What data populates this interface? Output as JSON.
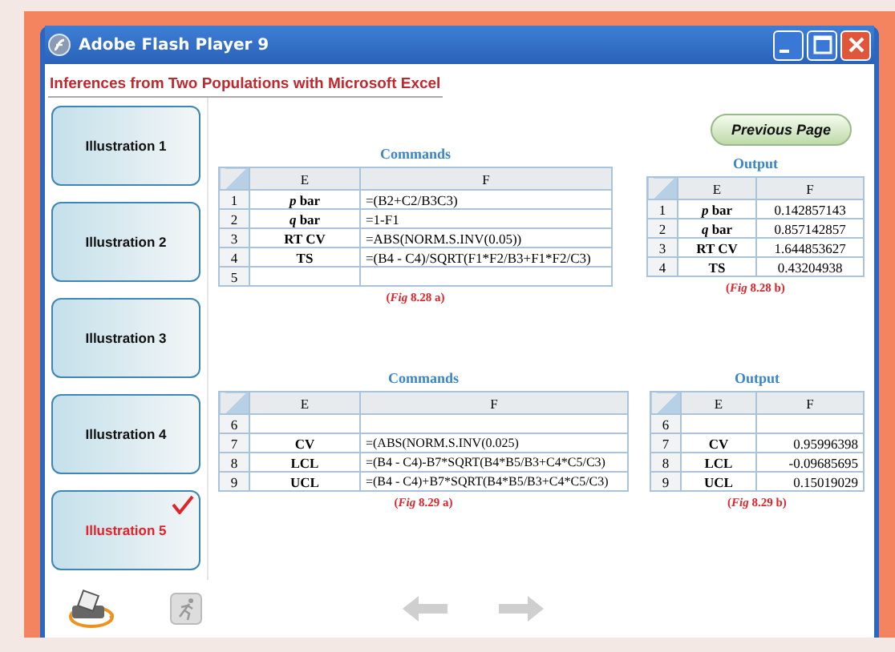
{
  "window": {
    "title": "Adobe Flash Player 9"
  },
  "heading": "Inferences from Two Populations with Microsoft Excel",
  "illustrations": [
    {
      "label": "Illustration 1",
      "selected": false,
      "checked": false
    },
    {
      "label": "Illustration 2",
      "selected": false,
      "checked": false
    },
    {
      "label": "Illustration 3",
      "selected": false,
      "checked": false
    },
    {
      "label": "Illustration 4",
      "selected": false,
      "checked": false
    },
    {
      "label": "Illustration 5",
      "selected": true,
      "checked": true
    }
  ],
  "previous_button": "Previous Page",
  "figures": [
    {
      "commands": {
        "title": "Commands",
        "columns": [
          "E",
          "F"
        ],
        "rows": [
          {
            "row": "1",
            "e": "*p* bar",
            "f": "=(B2+C2/B3C3)"
          },
          {
            "row": "2",
            "e": "*q* bar",
            "f": "=1-F1"
          },
          {
            "row": "3",
            "e": "RT CV",
            "f": "=ABS(NORM.S.INV(0.05))"
          },
          {
            "row": "4",
            "e": "TS",
            "f": "=(B4 - C4)/SQRT(F1*F2/B3+F1*F2/C3)"
          },
          {
            "row": "5"
          }
        ],
        "caption": "(*Fig* 8.28 a)"
      },
      "output": {
        "title": "Output",
        "columns": [
          "E",
          "F"
        ],
        "rows": [
          {
            "row": "1",
            "e": "*p* bar",
            "f": "0.142857143"
          },
          {
            "row": "2",
            "e": "*q* bar",
            "f": "0.857142857"
          },
          {
            "row": "3",
            "e": "RT CV",
            "f": "1.644853627"
          },
          {
            "row": "4",
            "e": "TS",
            "f": "0.43204938"
          }
        ],
        "caption": "(*Fig* 8.28 b)"
      }
    },
    {
      "commands": {
        "title": "Commands",
        "columns": [
          "E",
          "F"
        ],
        "rows": [
          {
            "row": "6"
          },
          {
            "row": "7",
            "e": "CV",
            "f": "=(ABS(NORM.S.INV(0.025)"
          },
          {
            "row": "8",
            "e": "LCL",
            "f": "=(B4 - C4)-B7*SQRT(B4*B5/B3+C4*C5/C3)"
          },
          {
            "row": "9",
            "e": "UCL",
            "f": "=(B4 - C4)+B7*SQRT(B4*B5/B3+C4*C5/C3)"
          }
        ],
        "caption": "(*Fig* 8.29 a)"
      },
      "output": {
        "title": "Output",
        "columns": [
          "E",
          "F"
        ],
        "rows": [
          {
            "row": "6"
          },
          {
            "row": "7",
            "e": "CV",
            "f": "0.95996398"
          },
          {
            "row": "8",
            "e": "LCL",
            "f": "-0.09685695"
          },
          {
            "row": "9",
            "e": "UCL",
            "f": "0.15019029"
          }
        ],
        "caption": "(*Fig* 8.29 b)"
      }
    }
  ]
}
